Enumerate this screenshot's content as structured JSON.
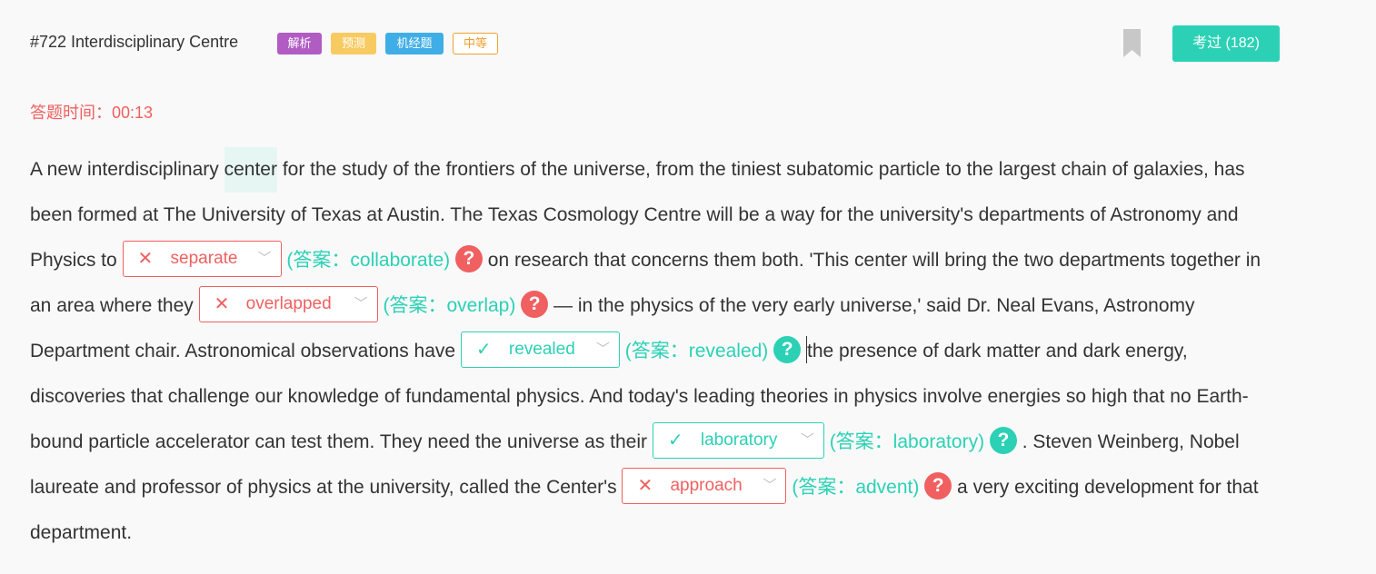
{
  "header": {
    "title": "#722 Interdisciplinary Centre",
    "tags": [
      "解析",
      "预测",
      "机经题",
      "中等"
    ],
    "exam_button": "考过 (182)"
  },
  "timer": "答题时间：00:13",
  "passage": {
    "seg1": "A new interdisciplinary ",
    "highlight": "center",
    "seg2": " for the study of the frontiers of the universe, from the tiniest subatomic particle to the largest chain of galaxies, has been formed at The University of Texas at Austin. The Texas Cosmology Centre will be a way for the university's departments of Astronomy and Physics to ",
    "seg3": " on research that concerns them both. 'This center will bring the two departments together in an area where they ",
    "seg4": " — in the physics of the very early universe,' said Dr. Neal Evans, Astronomy Department chair. Astronomical observations have ",
    "seg5": "the presence of dark matter and dark energy, discoveries that challenge our knowledge of fundamental physics. And today's leading theories in physics involve energies so high that no Earth-bound particle accelerator can test them. They need the universe as their ",
    "seg6": " . Steven Weinberg, Nobel laureate and professor of physics at the university, called the Center's",
    "seg7": " a very exciting development for that department."
  },
  "blanks": [
    {
      "selected": "separate",
      "answer": "(答案：collaborate)",
      "correct": false,
      "mark": "✕"
    },
    {
      "selected": "overlapped",
      "answer": "(答案：overlap)",
      "correct": false,
      "mark": "✕"
    },
    {
      "selected": "revealed",
      "answer": "(答案：revealed)",
      "correct": true,
      "mark": "✓"
    },
    {
      "selected": "laboratory",
      "answer": "(答案：laboratory)",
      "correct": true,
      "mark": "✓"
    },
    {
      "selected": "approach",
      "answer": "(答案：advent)",
      "correct": false,
      "mark": "✕"
    }
  ],
  "colors": {
    "accent": "#2cd1b5",
    "wrong": "#f06060",
    "tag_analysis": "#b05cc3",
    "tag_predict": "#f8cb62",
    "tag_machine": "#40aee6",
    "tag_medium": "#f0a030"
  },
  "icons": {
    "bookmark": "bookmark-icon",
    "help": "question-mark-icon",
    "dropdown": "chevron-down-icon"
  }
}
